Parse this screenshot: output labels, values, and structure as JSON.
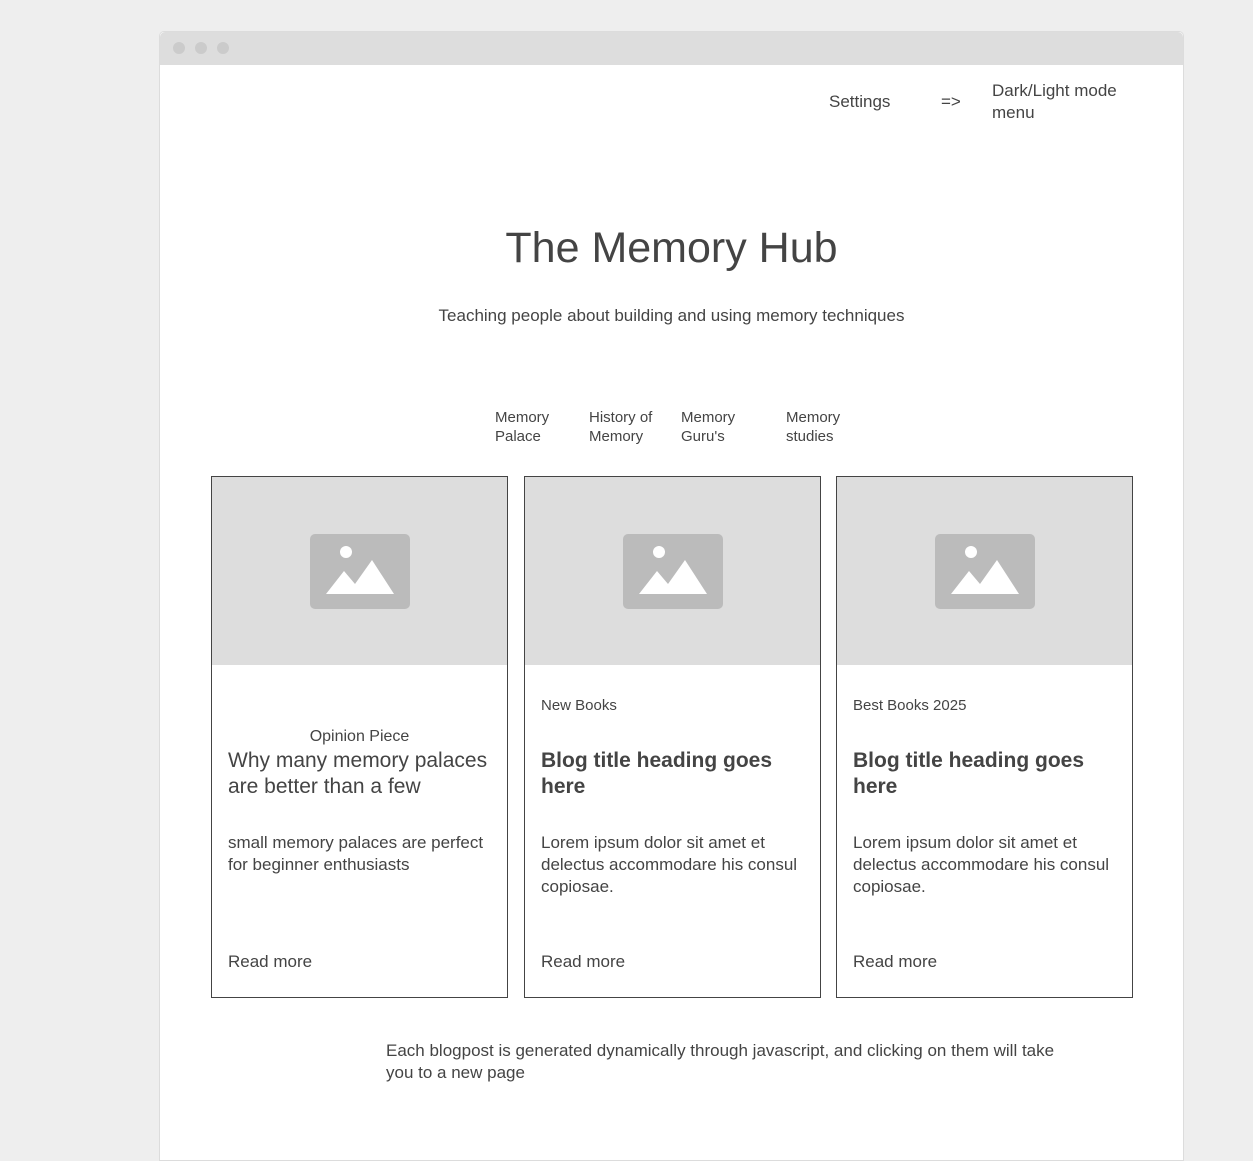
{
  "header": {
    "settings_label": "Settings",
    "arrow_label": "=>",
    "mode_menu_label": "Dark/Light mode menu"
  },
  "hero": {
    "title": "The Memory Hub",
    "subtitle": "Teaching people about building and using memory techniques"
  },
  "nav": {
    "items": [
      {
        "line1": "Memory",
        "line2": "Palace"
      },
      {
        "line1": "History of",
        "line2": "Memory"
      },
      {
        "line1": "Memory",
        "line2": "Guru's"
      },
      {
        "line1": "Memory",
        "line2": "studies"
      }
    ]
  },
  "cards": [
    {
      "category": "Opinion Piece",
      "heading": "Why many memory palaces are better than a few",
      "body": "small memory palaces are perfect for beginner enthusiasts",
      "link": "Read more"
    },
    {
      "category": "New Books",
      "heading": "Blog title heading goes here",
      "body": "Lorem ipsum dolor sit amet et delectus accommodare his consul copiosae.",
      "link": "Read more"
    },
    {
      "category": "Best Books 2025",
      "heading": "Blog title heading goes here",
      "body": "Lorem ipsum dolor sit amet et delectus accommodare his consul copiosae.",
      "link": "Read more"
    }
  ],
  "footer_note": "Each blogpost is generated dynamically through javascript, and clicking on them will take you to a new page",
  "icons": {
    "window_dots": "window-control-dot-icon",
    "card_image": "image-placeholder-icon"
  },
  "colors": {
    "background": "#eeeeee",
    "window": "#ffffff",
    "titlebar": "#dddddd",
    "text": "#444444",
    "placeholder": "#dddddd",
    "placeholder_icon": "#bbbbbb"
  }
}
